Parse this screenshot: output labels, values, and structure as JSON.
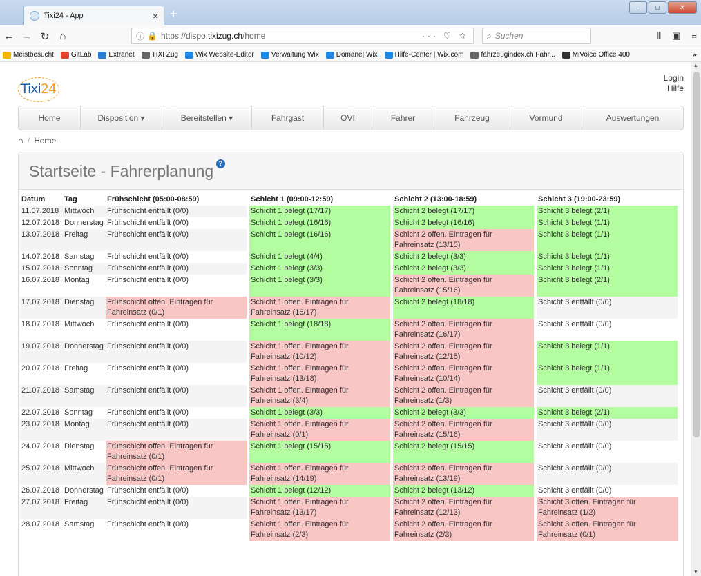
{
  "browser": {
    "tab_title": "Tixi24 - App",
    "tab_close": "×",
    "new_tab": "+",
    "url_host": "https://dispo.",
    "url_domain": "tixizug.ch",
    "url_path": "/home",
    "url_tools": "··· ♡ ☆",
    "search_placeholder": "Suchen",
    "bookmarks_more": "»",
    "bookmarks": [
      {
        "label": "Meistbesucht",
        "color": "#f2b500"
      },
      {
        "label": "GitLab",
        "color": "#e2432a"
      },
      {
        "label": "Extranet",
        "color": "#2b7cd3"
      },
      {
        "label": "TIXI Zug",
        "color": "#666666"
      },
      {
        "label": "Wix Website-Editor",
        "color": "#1e88e5"
      },
      {
        "label": "Verwaltung Wix",
        "color": "#1e88e5"
      },
      {
        "label": "Domäne| Wix",
        "color": "#1e88e5"
      },
      {
        "label": "Hilfe-Center | Wix.com",
        "color": "#1e88e5"
      },
      {
        "label": "fahrzeugindex.ch Fahr...",
        "color": "#666666"
      },
      {
        "label": "MiVoice Office 400",
        "color": "#333333"
      }
    ]
  },
  "header": {
    "logo_text": "Tixi",
    "logo_num": "24",
    "login": "Login",
    "help": "Hilfe"
  },
  "menu": [
    {
      "label": "Home",
      "w": 90
    },
    {
      "label": "Disposition ▾",
      "w": 118
    },
    {
      "label": "Bereitstellen ▾",
      "w": 130
    },
    {
      "label": "Fahrgast",
      "w": 104
    },
    {
      "label": "OVI",
      "w": 70
    },
    {
      "label": "Fahrer",
      "w": 90
    },
    {
      "label": "Fahrzeug",
      "w": 110
    },
    {
      "label": "Vormund",
      "w": 104
    },
    {
      "label": "Auswertungen",
      "w": 146
    }
  ],
  "breadcrumb": {
    "sep": "/",
    "current": "Home"
  },
  "panel": {
    "title": "Startseite - Fahrerplanung",
    "help": "?"
  },
  "table": {
    "headers": [
      "Datum",
      "Tag",
      "Frühschicht (05:00-08:59)",
      "Schicht 1 (09:00-12:59)",
      "Schicht 2 (13:00-18:59)",
      "Schicht 3 (19:00-23:59)"
    ],
    "rows": [
      {
        "date": "11.07.2018",
        "day": "Mittwoch",
        "cells": [
          [
            "Frühschicht entfällt (0/0)",
            "plain"
          ],
          [
            "Schicht 1 belegt (17/17)",
            "green"
          ],
          [
            "Schicht 2 belegt (17/17)",
            "green"
          ],
          [
            "Schicht 3 belegt (2/1)",
            "green"
          ]
        ]
      },
      {
        "date": "12.07.2018",
        "day": "Donnerstag",
        "cells": [
          [
            "Frühschicht entfällt (0/0)",
            "plain"
          ],
          [
            "Schicht 1 belegt (16/16)",
            "green"
          ],
          [
            "Schicht 2 belegt (16/16)",
            "green"
          ],
          [
            "Schicht 3 belegt (1/1)",
            "green"
          ]
        ]
      },
      {
        "date": "13.07.2018",
        "day": "Freitag",
        "cells": [
          [
            "Frühschicht entfällt (0/0)",
            "plain"
          ],
          [
            "Schicht 1 belegt (16/16)",
            "green"
          ],
          [
            "Schicht 2 offen. Eintragen für Fahreinsatz (13/15)",
            "red"
          ],
          [
            "Schicht 3 belegt (1/1)",
            "green"
          ]
        ]
      },
      {
        "date": "14.07.2018",
        "day": "Samstag",
        "cells": [
          [
            "Frühschicht entfällt (0/0)",
            "plain"
          ],
          [
            "Schicht 1 belegt (4/4)",
            "green"
          ],
          [
            "Schicht 2 belegt (3/3)",
            "green"
          ],
          [
            "Schicht 3 belegt (1/1)",
            "green"
          ]
        ]
      },
      {
        "date": "15.07.2018",
        "day": "Sonntag",
        "cells": [
          [
            "Frühschicht entfällt (0/0)",
            "plain"
          ],
          [
            "Schicht 1 belegt (3/3)",
            "green"
          ],
          [
            "Schicht 2 belegt (3/3)",
            "green"
          ],
          [
            "Schicht 3 belegt (1/1)",
            "green"
          ]
        ]
      },
      {
        "date": "16.07.2018",
        "day": "Montag",
        "cells": [
          [
            "Frühschicht entfällt (0/0)",
            "plain"
          ],
          [
            "Schicht 1 belegt (3/3)",
            "green"
          ],
          [
            "Schicht 2 offen. Eintragen für Fahreinsatz (15/16)",
            "red"
          ],
          [
            "Schicht 3 belegt (2/1)",
            "green"
          ]
        ]
      },
      {
        "date": "17.07.2018",
        "day": "Dienstag",
        "cells": [
          [
            "Frühschicht offen. Eintragen für Fahreinsatz (0/1)",
            "red"
          ],
          [
            "Schicht 1 offen. Eintragen für Fahreinsatz (16/17)",
            "red"
          ],
          [
            "Schicht 2 belegt (18/18)",
            "green"
          ],
          [
            "Schicht 3 entfällt (0/0)",
            "plain"
          ]
        ]
      },
      {
        "date": "18.07.2018",
        "day": "Mittwoch",
        "cells": [
          [
            "Frühschicht entfällt (0/0)",
            "plain"
          ],
          [
            "Schicht 1 belegt (18/18)",
            "green"
          ],
          [
            "Schicht 2 offen. Eintragen für Fahreinsatz (16/17)",
            "red"
          ],
          [
            "Schicht 3 entfällt (0/0)",
            "plain"
          ]
        ]
      },
      {
        "date": "19.07.2018",
        "day": "Donnerstag",
        "cells": [
          [
            "Frühschicht entfällt (0/0)",
            "plain"
          ],
          [
            "Schicht 1 offen. Eintragen für Fahreinsatz (10/12)",
            "red"
          ],
          [
            "Schicht 2 offen. Eintragen für Fahreinsatz (12/15)",
            "red"
          ],
          [
            "Schicht 3 belegt (1/1)",
            "green"
          ]
        ]
      },
      {
        "date": "20.07.2018",
        "day": "Freitag",
        "cells": [
          [
            "Frühschicht entfällt (0/0)",
            "plain"
          ],
          [
            "Schicht 1 offen. Eintragen für Fahreinsatz (13/18)",
            "red"
          ],
          [
            "Schicht 2 offen. Eintragen für Fahreinsatz (10/14)",
            "red"
          ],
          [
            "Schicht 3 belegt (1/1)",
            "green"
          ]
        ]
      },
      {
        "date": "21.07.2018",
        "day": "Samstag",
        "cells": [
          [
            "Frühschicht entfällt (0/0)",
            "plain"
          ],
          [
            "Schicht 1 offen. Eintragen für Fahreinsatz (3/4)",
            "red"
          ],
          [
            "Schicht 2 offen. Eintragen für Fahreinsatz (1/3)",
            "red"
          ],
          [
            "Schicht 3 entfällt (0/0)",
            "plain"
          ]
        ]
      },
      {
        "date": "22.07.2018",
        "day": "Sonntag",
        "cells": [
          [
            "Frühschicht entfällt (0/0)",
            "plain"
          ],
          [
            "Schicht 1 belegt (3/3)",
            "green"
          ],
          [
            "Schicht 2 belegt (3/3)",
            "green"
          ],
          [
            "Schicht 3 belegt (2/1)",
            "green"
          ]
        ]
      },
      {
        "date": "23.07.2018",
        "day": "Montag",
        "cells": [
          [
            "Frühschicht entfällt (0/0)",
            "plain"
          ],
          [
            "Schicht 1 offen. Eintragen für Fahreinsatz (0/1)",
            "red"
          ],
          [
            "Schicht 2 offen. Eintragen für Fahreinsatz (15/16)",
            "red"
          ],
          [
            "Schicht 3 entfällt (0/0)",
            "plain"
          ]
        ]
      },
      {
        "date": "24.07.2018",
        "day": "Dienstag",
        "cells": [
          [
            "Frühschicht offen. Eintragen für Fahreinsatz (0/1)",
            "red"
          ],
          [
            "Schicht 1 belegt (15/15)",
            "green"
          ],
          [
            "Schicht 2 belegt (15/15)",
            "green"
          ],
          [
            "Schicht 3 entfällt (0/0)",
            "plain"
          ]
        ]
      },
      {
        "date": "25.07.2018",
        "day": "Mittwoch",
        "cells": [
          [
            "Frühschicht offen. Eintragen für Fahreinsatz (0/1)",
            "red"
          ],
          [
            "Schicht 1 offen. Eintragen für Fahreinsatz (14/19)",
            "red"
          ],
          [
            "Schicht 2 offen. Eintragen für Fahreinsatz (13/19)",
            "red"
          ],
          [
            "Schicht 3 entfällt (0/0)",
            "plain"
          ]
        ]
      },
      {
        "date": "26.07.2018",
        "day": "Donnerstag",
        "cells": [
          [
            "Frühschicht entfällt (0/0)",
            "plain"
          ],
          [
            "Schicht 1 belegt (12/12)",
            "green"
          ],
          [
            "Schicht 2 belegt (13/12)",
            "green"
          ],
          [
            "Schicht 3 entfällt (0/0)",
            "plain"
          ]
        ]
      },
      {
        "date": "27.07.2018",
        "day": "Freitag",
        "cells": [
          [
            "Frühschicht entfällt (0/0)",
            "plain"
          ],
          [
            "Schicht 1 offen. Eintragen für Fahreinsatz (13/17)",
            "red"
          ],
          [
            "Schicht 2 offen. Eintragen für Fahreinsatz (12/13)",
            "red"
          ],
          [
            "Schicht 3 offen. Eintragen für Fahreinsatz (1/2)",
            "red"
          ]
        ]
      },
      {
        "date": "28.07.2018",
        "day": "Samstag",
        "cells": [
          [
            "Frühschicht entfällt (0/0)",
            "plain"
          ],
          [
            "Schicht 1 offen. Eintragen für Fahreinsatz (2/3)",
            "red"
          ],
          [
            "Schicht 2 offen. Eintragen für Fahreinsatz (2/3)",
            "red"
          ],
          [
            "Schicht 3 offen. Eintragen für Fahreinsatz (0/1)",
            "red"
          ]
        ]
      }
    ]
  },
  "colors": {
    "belegt": "#b3fca0",
    "offen": "#f9c6c6",
    "brand": "#1d5ea8",
    "accent": "#f4a11c"
  }
}
